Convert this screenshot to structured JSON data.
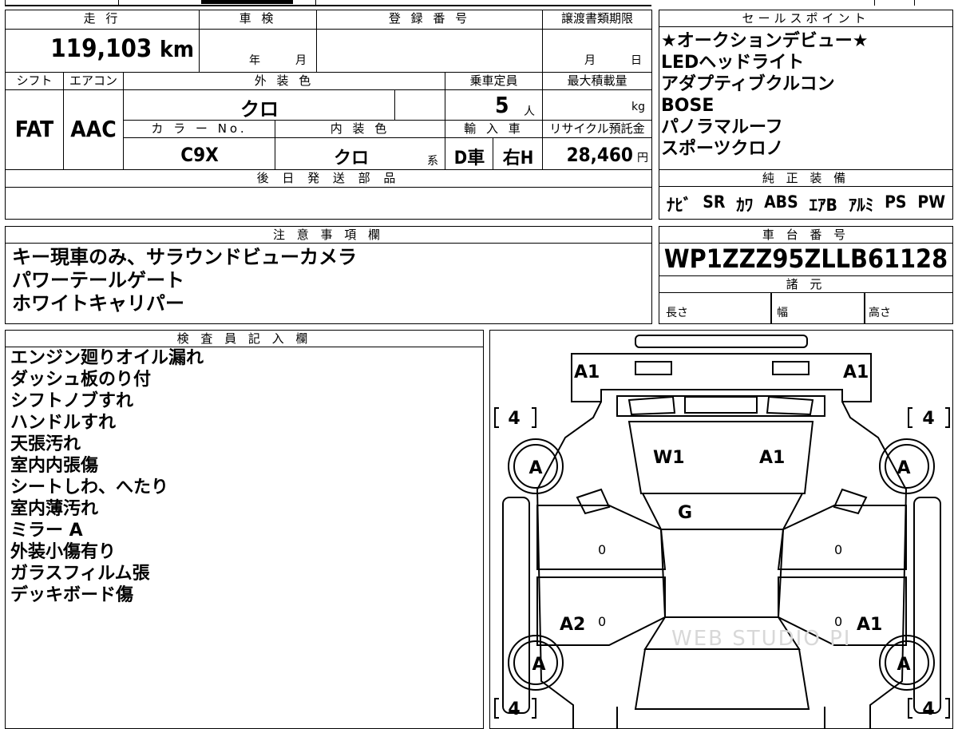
{
  "main": {
    "headers": {
      "mileage": "走 行",
      "inspection": "車 検",
      "registration": "登 録 番 号",
      "transfer_deadline": "譲渡書類期限",
      "shift": "シフト",
      "aircon": "エアコン",
      "exterior_color": "外 装 色",
      "capacity": "乗車定員",
      "max_load": "最大積載量",
      "color_no": "カ ラ ー No.",
      "interior_color": "内 装 色",
      "import": "輸 入 車",
      "recycle_fee": "リサイクル預託金",
      "later_parts": "後 日 発 送 部 品"
    },
    "mileage_value": "119,103",
    "mileage_unit": "km",
    "inspection_year": "年",
    "inspection_month": "月",
    "transfer_month": "月",
    "transfer_day": "日",
    "shift_value": "FAT",
    "aircon_value": "AAC",
    "exterior_color_value": "クロ",
    "capacity_value": "5",
    "capacity_unit": "人",
    "max_load_unit": "kg",
    "color_no_value": "C9X",
    "interior_color_value": "クロ",
    "interior_color_suffix": "系",
    "import_value": "D車",
    "handle_value": "右H",
    "recycle_value": "28,460",
    "recycle_unit": "円"
  },
  "sales": {
    "header": "セールスポイント",
    "lines": [
      "★オークションデビュー★",
      "LEDヘッドライト",
      "アダプティブクルコン",
      "BOSE",
      "パノラマルーフ",
      "スポーツクロノ"
    ]
  },
  "equipment": {
    "header": "純 正 装 備",
    "items": [
      "ﾅﾋﾞ",
      "SR",
      "ｶﾜ",
      "ABS",
      "ｴｱB",
      "ｱﾙﾐ",
      "PS",
      "PW"
    ]
  },
  "notes": {
    "header": "注 意 事 項 欄",
    "lines": [
      "キー現車のみ、サラウンドビューカメラ",
      "パワーテールゲート",
      "ホワイトキャリパー"
    ]
  },
  "chassis": {
    "header": "車 台 番 号",
    "value": "WP1ZZZ95ZLLB61128"
  },
  "specs": {
    "header": "諸 元",
    "length_label": "長さ",
    "width_label": "幅",
    "height_label": "高さ"
  },
  "inspector": {
    "header": "検 査 員 記 入 欄",
    "lines": [
      "エンジン廻りオイル漏れ",
      "ダッシュ板のり付",
      "シフトノブすれ",
      "ハンドルすれ",
      "天張汚れ",
      "室内内張傷",
      "シートしわ、へたり",
      "室内薄汚れ",
      "ミラー A",
      "外装小傷有り",
      "ガラスフィルム張",
      "デッキボード傷"
    ]
  },
  "diagram": {
    "marks": {
      "front_left": "A1",
      "front_right": "A1",
      "hood_left": "W1",
      "hood_right": "A1",
      "roof": "G",
      "rear_left_door": "A2",
      "rear_right_door": "A1",
      "wheel_front_left": "A",
      "wheel_front_right": "A",
      "wheel_rear_left": "A",
      "wheel_rear_right": "A",
      "tire_fl": "4",
      "tire_fr": "4",
      "tire_rl": "4",
      "tire_rr": "4",
      "zero": "0"
    },
    "watermark": "WEB STUDIO PI"
  }
}
